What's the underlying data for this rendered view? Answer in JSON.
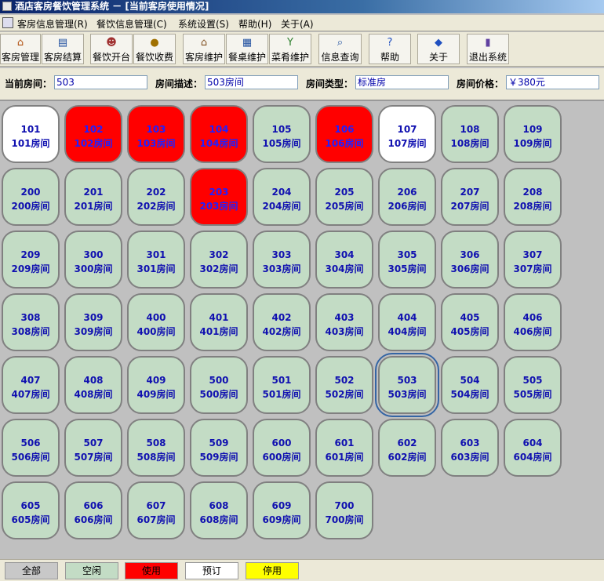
{
  "window": {
    "title": "酒店客房餐饮管理系统 － [当前客房使用情况]"
  },
  "menu": [
    {
      "label": "客房信息管理(R)"
    },
    {
      "label": "餐饮信息管理(C)"
    },
    {
      "label": "系统设置(S)"
    },
    {
      "label": "帮助(H)"
    },
    {
      "label": "关于(A)"
    }
  ],
  "toolbar": [
    {
      "label": "客房管理",
      "icon": "house-icon"
    },
    {
      "label": "客房结算",
      "icon": "bill-icon"
    },
    {
      "label": "餐饮开台",
      "icon": "people-icon"
    },
    {
      "label": "餐饮收费",
      "icon": "money-icon"
    },
    {
      "label": "客房维护",
      "icon": "house-wrench-icon"
    },
    {
      "label": "餐桌维护",
      "icon": "table-icon"
    },
    {
      "label": "菜肴维护",
      "icon": "glass-icon"
    },
    {
      "label": "信息查询",
      "icon": "magnifier-icon"
    },
    {
      "label": "帮助",
      "icon": "help-icon"
    },
    {
      "label": "关于",
      "icon": "info-icon"
    },
    {
      "label": "退出系统",
      "icon": "exit-door-icon"
    }
  ],
  "info": {
    "current_room_label": "当前房间：",
    "current_room_value": "503",
    "desc_label": "房间描述：",
    "desc_value": "503房间",
    "type_label": "房间类型：",
    "type_value": "标准房",
    "price_label": "房间价格：",
    "price_value": "￥380元"
  },
  "rooms": [
    {
      "num": "101",
      "desc": "101房间",
      "status": "reserved"
    },
    {
      "num": "102",
      "desc": "102房间",
      "status": "inuse"
    },
    {
      "num": "103",
      "desc": "103房间",
      "status": "inuse"
    },
    {
      "num": "104",
      "desc": "104房间",
      "status": "inuse"
    },
    {
      "num": "105",
      "desc": "105房间",
      "status": "vacant"
    },
    {
      "num": "106",
      "desc": "106房间",
      "status": "inuse"
    },
    {
      "num": "107",
      "desc": "107房间",
      "status": "reserved"
    },
    {
      "num": "108",
      "desc": "108房间",
      "status": "vacant"
    },
    {
      "num": "109",
      "desc": "109房间",
      "status": "vacant"
    },
    {
      "num": "200",
      "desc": "200房间",
      "status": "vacant"
    },
    {
      "num": "201",
      "desc": "201房间",
      "status": "vacant"
    },
    {
      "num": "202",
      "desc": "202房间",
      "status": "vacant"
    },
    {
      "num": "203",
      "desc": "203房间",
      "status": "inuse"
    },
    {
      "num": "204",
      "desc": "204房间",
      "status": "vacant"
    },
    {
      "num": "205",
      "desc": "205房间",
      "status": "vacant"
    },
    {
      "num": "206",
      "desc": "206房间",
      "status": "vacant"
    },
    {
      "num": "207",
      "desc": "207房间",
      "status": "vacant"
    },
    {
      "num": "208",
      "desc": "208房间",
      "status": "vacant"
    },
    {
      "num": "209",
      "desc": "209房间",
      "status": "vacant"
    },
    {
      "num": "300",
      "desc": "300房间",
      "status": "vacant"
    },
    {
      "num": "301",
      "desc": "301房间",
      "status": "vacant"
    },
    {
      "num": "302",
      "desc": "302房间",
      "status": "vacant"
    },
    {
      "num": "303",
      "desc": "303房间",
      "status": "vacant"
    },
    {
      "num": "304",
      "desc": "304房间",
      "status": "vacant"
    },
    {
      "num": "305",
      "desc": "305房间",
      "status": "vacant"
    },
    {
      "num": "306",
      "desc": "306房间",
      "status": "vacant"
    },
    {
      "num": "307",
      "desc": "307房间",
      "status": "vacant"
    },
    {
      "num": "308",
      "desc": "308房间",
      "status": "vacant"
    },
    {
      "num": "309",
      "desc": "309房间",
      "status": "vacant"
    },
    {
      "num": "400",
      "desc": "400房间",
      "status": "vacant"
    },
    {
      "num": "401",
      "desc": "401房间",
      "status": "vacant"
    },
    {
      "num": "402",
      "desc": "402房间",
      "status": "vacant"
    },
    {
      "num": "403",
      "desc": "403房间",
      "status": "vacant"
    },
    {
      "num": "404",
      "desc": "404房间",
      "status": "vacant"
    },
    {
      "num": "405",
      "desc": "405房间",
      "status": "vacant"
    },
    {
      "num": "406",
      "desc": "406房间",
      "status": "vacant"
    },
    {
      "num": "407",
      "desc": "407房间",
      "status": "vacant"
    },
    {
      "num": "408",
      "desc": "408房间",
      "status": "vacant"
    },
    {
      "num": "409",
      "desc": "409房间",
      "status": "vacant"
    },
    {
      "num": "500",
      "desc": "500房间",
      "status": "vacant"
    },
    {
      "num": "501",
      "desc": "501房间",
      "status": "vacant"
    },
    {
      "num": "502",
      "desc": "502房间",
      "status": "vacant"
    },
    {
      "num": "503",
      "desc": "503房间",
      "status": "vacant",
      "selected": true
    },
    {
      "num": "504",
      "desc": "504房间",
      "status": "vacant"
    },
    {
      "num": "505",
      "desc": "505房间",
      "status": "vacant"
    },
    {
      "num": "506",
      "desc": "506房间",
      "status": "vacant"
    },
    {
      "num": "507",
      "desc": "507房间",
      "status": "vacant"
    },
    {
      "num": "508",
      "desc": "508房间",
      "status": "vacant"
    },
    {
      "num": "509",
      "desc": "509房间",
      "status": "vacant"
    },
    {
      "num": "600",
      "desc": "600房间",
      "status": "vacant"
    },
    {
      "num": "601",
      "desc": "601房间",
      "status": "vacant"
    },
    {
      "num": "602",
      "desc": "602房间",
      "status": "vacant"
    },
    {
      "num": "603",
      "desc": "603房间",
      "status": "vacant"
    },
    {
      "num": "604",
      "desc": "604房间",
      "status": "vacant"
    },
    {
      "num": "605",
      "desc": "605房间",
      "status": "vacant"
    },
    {
      "num": "606",
      "desc": "606房间",
      "status": "vacant"
    },
    {
      "num": "607",
      "desc": "607房间",
      "status": "vacant"
    },
    {
      "num": "608",
      "desc": "608房间",
      "status": "vacant"
    },
    {
      "num": "609",
      "desc": "609房间",
      "status": "vacant"
    },
    {
      "num": "700",
      "desc": "700房间",
      "status": "vacant"
    }
  ],
  "legend": [
    {
      "label": "全部",
      "color": "#c8c8c8"
    },
    {
      "label": "空闲",
      "color": "#c3dcc5"
    },
    {
      "label": "使用",
      "color": "#ff0000"
    },
    {
      "label": "预订",
      "color": "#ffffff"
    },
    {
      "label": "停用",
      "color": "#ffff00"
    }
  ]
}
